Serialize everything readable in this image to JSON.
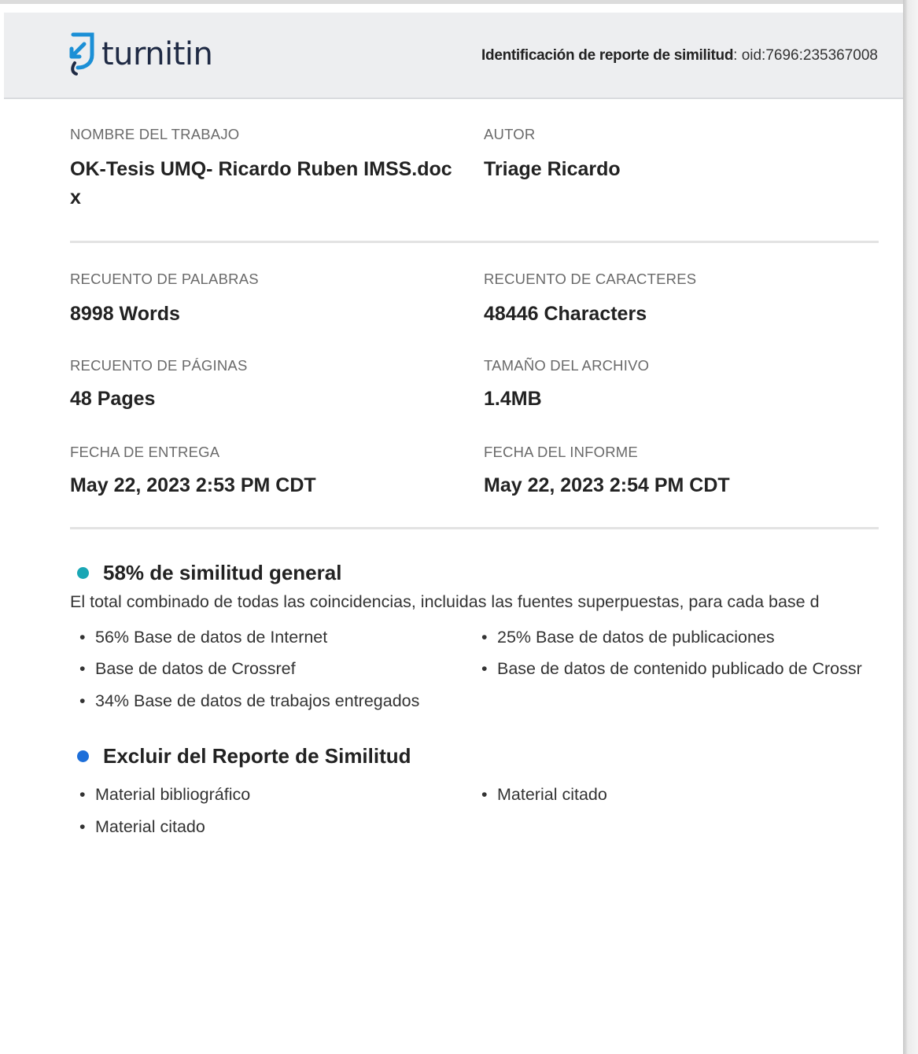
{
  "header": {
    "logo_text": "turnitin",
    "report_id_label": "Identificación de reporte de similitud",
    "report_id_value": "oid:7696:235367008"
  },
  "fields": {
    "job_name_label": "NOMBRE  DEL TRABAJO",
    "job_name_line1": "OK-Tesis UMQ- Ricardo Ruben IMSS.doc",
    "job_name_line2": "x",
    "author_label": "AUTOR",
    "author_value": "Triage Ricardo",
    "word_count_label": "RECUENTO DE PALABRAS",
    "word_count_value": "8998 Words",
    "char_count_label": "RECUENTO  DE CARACTERES",
    "char_count_value": "48446 Characters",
    "page_count_label": "RECUENTO  DE PÁGINAS",
    "page_count_value": "48 Pages",
    "file_size_label": "TAMAÑO DEL ARCHIVO",
    "file_size_value": "1.4MB",
    "submit_date_label": "FECHA DE ENTREGA",
    "submit_date_value": "May 22, 2023 2:53 PM CDT",
    "report_date_label": "FECHA DEL INFORME",
    "report_date_value": "May 22, 2023 2:54 PM CDT"
  },
  "similarity": {
    "title": "58% de similitud general",
    "description": "El total combinado de todas las coincidencias, incluidas las fuentes superpuestas, para cada base d",
    "dot_color": "#1aa7b5",
    "items_left": [
      "56% Base de datos de Internet",
      "Base de datos de Crossref",
      "34% Base de datos de trabajos entregados"
    ],
    "items_right": [
      "25% Base de datos de publicaciones",
      "Base de datos de contenido publicado de Crossr"
    ]
  },
  "exclude": {
    "title": "Excluir  del Reporte de Similitud",
    "dot_color": "#1e6fd9",
    "items_left": [
      "Material bibliográfico",
      "Material citado"
    ],
    "items_right": [
      "Material citado"
    ]
  }
}
